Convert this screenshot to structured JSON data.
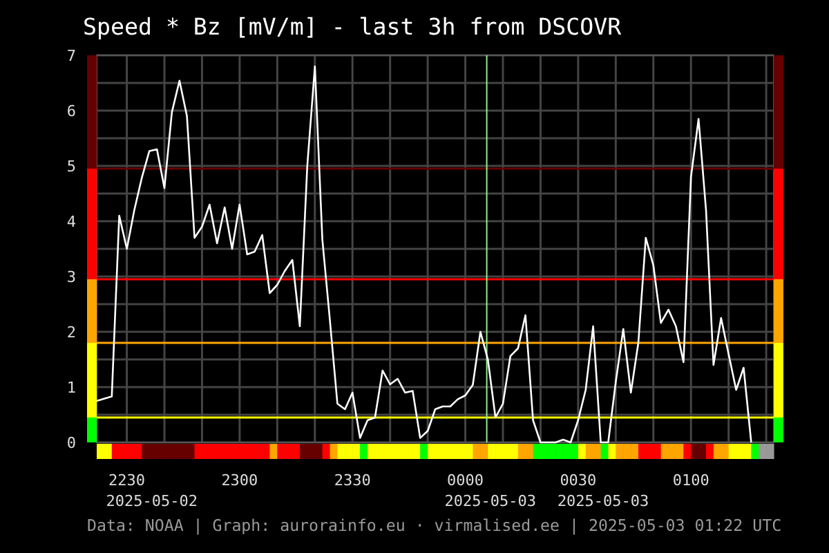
{
  "chart": {
    "levels": [
      {
        "color": "#00ff00"
      },
      {
        "color": "#ffff00"
      },
      {
        "color": "#ffa500"
      },
      {
        "color": "#ff0000"
      },
      {
        "color": "#660000"
      }
    ],
    "chart_data": {
      "type": "line",
      "title": "Speed * Bz [mV/m] - last 3h from DSCOVR",
      "categories": [
        null,
        null,
        null,
        null,
        "2230",
        null,
        null,
        null,
        null,
        null,
        null,
        null,
        null,
        null,
        null,
        null,
        null,
        null,
        null,
        "2300",
        null,
        null,
        null,
        null,
        null,
        null,
        null,
        null,
        null,
        null,
        null,
        null,
        null,
        null,
        "2330",
        null,
        null,
        null,
        null,
        null,
        null,
        null,
        null,
        null,
        null,
        null,
        null,
        null,
        null,
        "0000",
        null,
        null,
        null,
        null,
        null,
        null,
        null,
        null,
        null,
        null,
        null,
        null,
        null,
        null,
        "0030",
        null,
        null,
        null,
        null,
        null,
        null,
        null,
        null,
        null,
        null,
        null,
        null,
        null,
        null,
        "0100",
        null,
        null,
        null,
        null,
        null,
        null,
        null,
        null,
        null,
        null,
        null
      ],
      "series": [
        {
          "color": "#ffffff",
          "values": [
            0.75,
            0.79,
            0.83,
            4.1,
            3.5,
            4.2,
            4.79,
            5.27,
            5.3,
            4.6,
            5.97,
            6.54,
            5.9,
            3.7,
            3.9,
            4.3,
            3.6,
            4.25,
            3.5,
            4.3,
            3.4,
            3.45,
            3.75,
            2.7,
            2.85,
            3.1,
            3.3,
            2.1,
            5.0,
            6.8,
            3.67,
            2.2,
            0.7,
            0.6,
            0.9,
            0.08,
            0.4,
            0.45,
            1.3,
            1.05,
            1.15,
            0.9,
            0.93,
            0.08,
            0.21,
            0.6,
            0.65,
            0.65,
            0.78,
            0.85,
            1.04,
            2.0,
            1.5,
            0.45,
            0.7,
            1.56,
            1.7,
            2.3,
            0.4,
            0,
            0,
            0,
            0.05,
            0,
            0.4,
            0.95,
            2.1,
            0,
            0,
            1.1,
            2.05,
            0.9,
            1.8,
            3.7,
            3.2,
            2.16,
            2.4,
            2.1,
            1.45,
            4.8,
            5.85,
            4.2,
            1.4,
            2.25,
            1.6,
            0.95,
            1.35,
            0,
            null,
            null,
            null
          ]
        }
      ],
      "ylim": [
        0,
        7
      ],
      "yticks": [
        0,
        1,
        2,
        3,
        4,
        5,
        6,
        7
      ],
      "grid": true,
      "ref_lines": [
        {
          "axis": "y",
          "value": 0.45
        },
        {
          "axis": "y",
          "value": 1.8
        },
        {
          "axis": "y",
          "value": 2.95
        },
        {
          "axis": "y",
          "value": 4.95
        }
      ],
      "annotations": [
        "2025-05-02",
        "2025-05-03",
        "2025-05-03"
      ]
    }
  },
  "footer": "Data: NOAA | Graph: aurorainfo.eu · virmalised.ee | 2025-05-03 01:22 UTC"
}
